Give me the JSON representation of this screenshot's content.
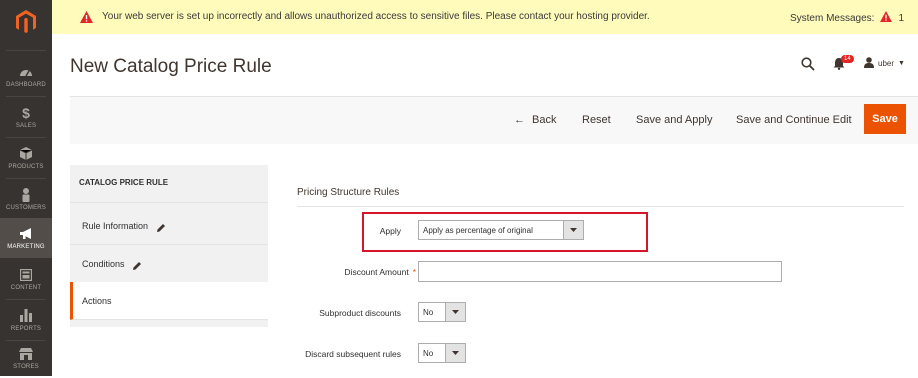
{
  "sidebar": {
    "logo_icon": "magento-logo-icon",
    "items": [
      {
        "label": "DASHBOARD",
        "icon": "dashboard-icon"
      },
      {
        "label": "SALES",
        "icon": "dollar-icon"
      },
      {
        "label": "PRODUCTS",
        "icon": "cube-icon"
      },
      {
        "label": "CUSTOMERS",
        "icon": "person-icon"
      },
      {
        "label": "MARKETING",
        "icon": "megaphone-icon",
        "active": true
      },
      {
        "label": "CONTENT",
        "icon": "layout-icon"
      },
      {
        "label": "REPORTS",
        "icon": "bar-chart-icon"
      },
      {
        "label": "STORES",
        "icon": "store-icon"
      }
    ]
  },
  "system_message": {
    "text": "Your web server is set up incorrectly and allows unauthorized access to sensitive files. Please contact your hosting provider.",
    "label": "System Messages:",
    "count": "1"
  },
  "header": {
    "title": "New Catalog Price Rule",
    "notifications_count": "14",
    "user": "uber"
  },
  "actions": {
    "back": "Back",
    "reset": "Reset",
    "save_apply": "Save and Apply",
    "save_continue": "Save and Continue Edit",
    "save": "Save"
  },
  "tabs": {
    "heading": "CATALOG PRICE RULE",
    "items": [
      {
        "label": "Rule Information"
      },
      {
        "label": "Conditions"
      },
      {
        "label": "Actions"
      }
    ]
  },
  "form": {
    "section_title": "Pricing Structure Rules",
    "apply_label": "Apply",
    "apply_value": "Apply as percentage of original",
    "discount_label": "Discount Amount",
    "discount_value": "",
    "subproduct_label": "Subproduct discounts",
    "subproduct_value": "No",
    "discard_label": "Discard subsequent rules",
    "discard_value": "No"
  },
  "colors": {
    "accent": "#eb5202",
    "sidebar_bg": "#373330",
    "highlight": "#d5162a",
    "sysmsg_bg": "#fffbbb"
  }
}
